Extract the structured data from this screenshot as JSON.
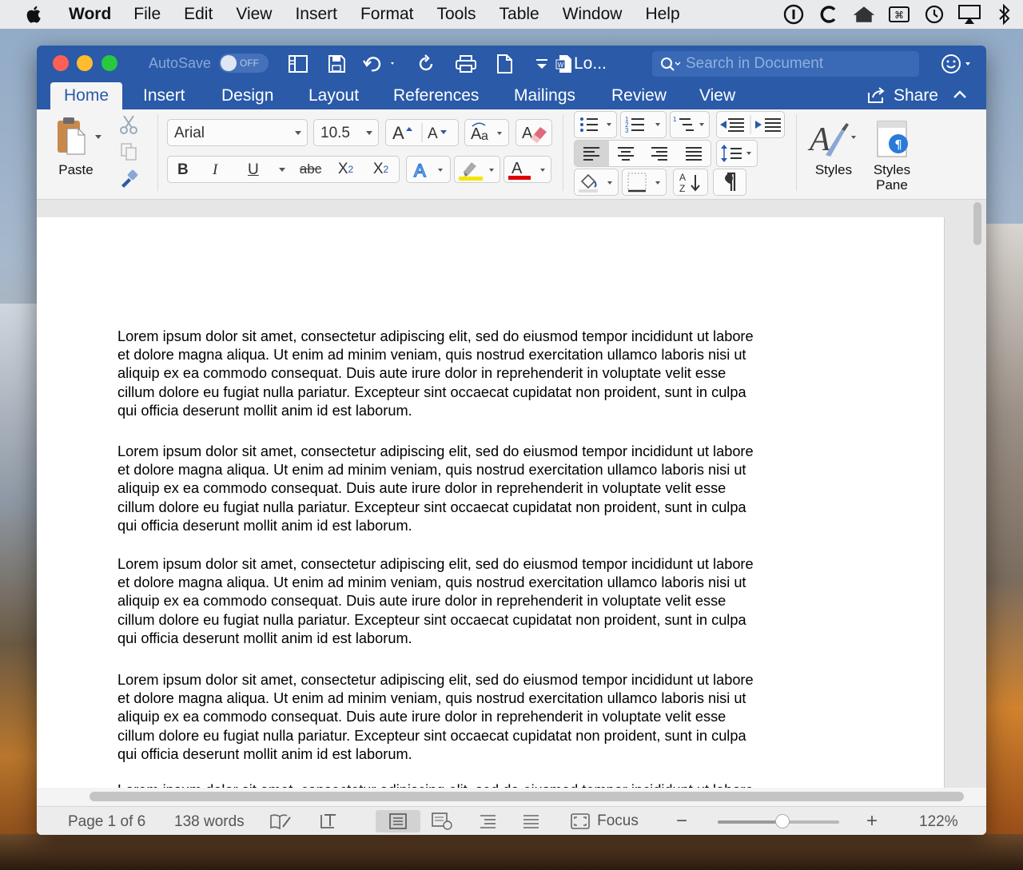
{
  "menubar": {
    "app_name": "Word",
    "items": [
      "File",
      "Edit",
      "View",
      "Insert",
      "Format",
      "Tools",
      "Table",
      "Window",
      "Help"
    ]
  },
  "window": {
    "autosave_label": "AutoSave",
    "autosave_state": "OFF",
    "doc_title": "Lo...",
    "search_placeholder": "Search in Document",
    "tabs": [
      "Home",
      "Insert",
      "Design",
      "Layout",
      "References",
      "Mailings",
      "Review",
      "View"
    ],
    "active_tab": "Home",
    "share_label": "Share"
  },
  "ribbon": {
    "paste_label": "Paste",
    "font_name": "Arial",
    "font_size": "10.5",
    "bold_label": "B",
    "italic_label": "I",
    "underline_label": "U",
    "strike_label": "abc",
    "sub_label": "X",
    "sub_mark": "2",
    "sup_label": "X",
    "sup_mark": "2",
    "styles_label": "Styles",
    "styles_pane_label_1": "Styles",
    "styles_pane_label_2": "Pane",
    "highlight_color": "#f6e500",
    "font_color": "#e00000"
  },
  "document": {
    "paragraphs": [
      [
        "Lorem ipsum dolor sit amet, consectetur adipiscing elit, sed do eiusmod tempor incididunt ut labore",
        "et dolore magna aliqua. Ut enim ad minim veniam, quis nostrud exercitation ullamco laboris nisi ut",
        "aliquip ex ea commodo consequat. Duis aute irure dolor in reprehenderit in voluptate velit esse",
        "cillum dolore eu fugiat nulla pariatur. Excepteur sint occaecat cupidatat non proident, sunt in culpa",
        "qui officia deserunt mollit anim id est laborum."
      ],
      [
        "Lorem ipsum dolor sit amet, consectetur adipiscing elit, sed do eiusmod tempor incididunt ut labore",
        "et dolore magna aliqua. Ut enim ad minim veniam, quis nostrud exercitation ullamco laboris nisi ut",
        "aliquip ex ea commodo consequat. Duis aute irure dolor in reprehenderit in voluptate velit esse",
        "cillum dolore eu fugiat nulla pariatur. Excepteur sint occaecat cupidatat non proident, sunt in culpa",
        "qui officia deserunt mollit anim id est laborum."
      ],
      [
        "Lorem ipsum dolor sit amet, consectetur adipiscing elit, sed do eiusmod tempor incididunt ut labore",
        "et dolore magna aliqua. Ut enim ad minim veniam, quis nostrud exercitation ullamco laboris nisi ut",
        "aliquip ex ea commodo consequat. Duis aute irure dolor in reprehenderit in voluptate velit esse",
        "cillum dolore eu fugiat nulla pariatur. Excepteur sint occaecat cupidatat non proident, sunt in culpa",
        "qui officia deserunt mollit anim id est laborum."
      ],
      [
        "Lorem ipsum dolor sit amet, consectetur adipiscing elit, sed do eiusmod tempor incididunt ut labore",
        "et dolore magna aliqua. Ut enim ad minim veniam, quis nostrud exercitation ullamco laboris nisi ut",
        "aliquip ex ea commodo consequat. Duis aute irure dolor in reprehenderit in voluptate velit esse",
        "cillum dolore eu fugiat nulla pariatur. Excepteur sint occaecat cupidatat non proident, sunt in culpa",
        "qui officia deserunt mollit anim id est laborum."
      ]
    ]
  },
  "statusbar": {
    "page_info": "Page 1 of 6",
    "word_count": "138 words",
    "focus_label": "Focus",
    "zoom_out": "−",
    "zoom_in": "+",
    "zoom_level": "122%",
    "zoom_fraction": 0.53
  }
}
